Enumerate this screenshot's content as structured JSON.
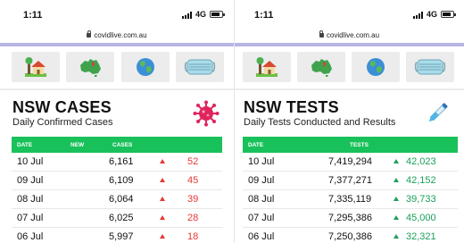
{
  "left": {
    "status": {
      "time": "1:11",
      "network": "4G"
    },
    "url": "covidlive.com.au",
    "title": "NSW CASES",
    "subtitle": "Daily Confirmed Cases",
    "headers": {
      "date": "DATE",
      "new": "NEW",
      "cases": "CASES"
    },
    "rows": [
      {
        "date": "10 Jul",
        "cases": "6,161",
        "change": "52"
      },
      {
        "date": "09 Jul",
        "cases": "6,109",
        "change": "45"
      },
      {
        "date": "08 Jul",
        "cases": "6,064",
        "change": "39"
      },
      {
        "date": "07 Jul",
        "cases": "6,025",
        "change": "28"
      },
      {
        "date": "06 Jul",
        "cases": "5,997",
        "change": "18"
      }
    ]
  },
  "right": {
    "status": {
      "time": "1:11",
      "network": "4G"
    },
    "url": "covidlive.com.au",
    "title": "NSW TESTS",
    "subtitle": "Daily Tests Conducted and Results",
    "headers": {
      "date": "DATE",
      "tests": "TESTS"
    },
    "rows": [
      {
        "date": "10 Jul",
        "tests": "7,419,294",
        "change": "42,023"
      },
      {
        "date": "09 Jul",
        "tests": "7,377,271",
        "change": "42,152"
      },
      {
        "date": "08 Jul",
        "tests": "7,335,119",
        "change": "39,733"
      },
      {
        "date": "07 Jul",
        "tests": "7,295,386",
        "change": "45,000"
      },
      {
        "date": "06 Jul",
        "tests": "7,250,386",
        "change": "32,321"
      }
    ]
  },
  "nav_icons": [
    "house-icon",
    "australia-map-icon",
    "globe-icon",
    "face-mask-icon"
  ],
  "colors": {
    "header_green": "#19c15b",
    "increase_red": "#e53935",
    "increase_green": "#1aa05a",
    "browser_band": "#b7b5e4"
  }
}
